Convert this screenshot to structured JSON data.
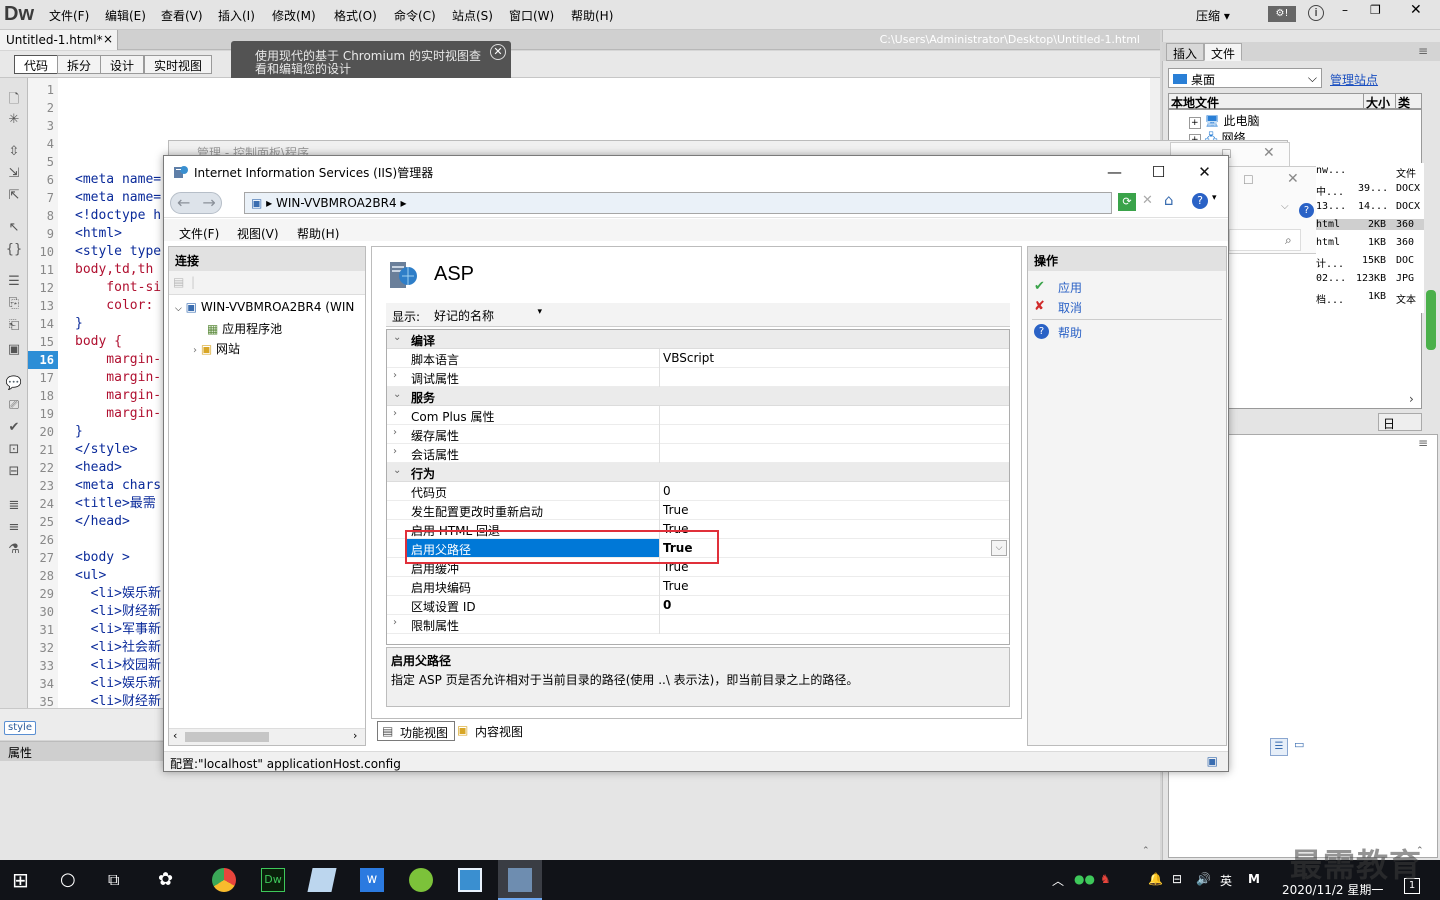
{
  "dw": {
    "logo": "Dw",
    "menus": [
      "文件(F)",
      "编辑(E)",
      "查看(V)",
      "插入(I)",
      "修改(M)",
      "格式(O)",
      "命令(C)",
      "站点(S)",
      "窗口(W)",
      "帮助(H)"
    ],
    "compress": "压缩",
    "doc_tab": "Untitled-1.html*",
    "doc_tab_close": "×",
    "path": "C:\\Users\\Administrator\\Desktop\\Untitled-1.html",
    "view_buttons": [
      "代码",
      "拆分",
      "设计",
      "实时视图"
    ],
    "tip_line1": "使用现代的基于 Chromium 的实时视图查",
    "tip_line2": "看和编辑您的设计",
    "line_numbers": [
      "1",
      "2",
      "3",
      "4",
      "5",
      "6",
      "7",
      "8",
      "9",
      "10",
      "11",
      "12",
      "13",
      "14",
      "15",
      "16",
      "17",
      "18",
      "19",
      "20",
      "21",
      "22",
      "23",
      "24",
      "25",
      "26",
      "27",
      "28",
      "29",
      "30",
      "31",
      "32",
      "33",
      "34",
      "35"
    ],
    "current_line": "16",
    "code_lines": [
      "",
      "",
      "",
      "",
      "",
      "<meta name=",
      "<meta name=",
      "<!doctype h",
      "<html>",
      "<style type",
      "body,td,th",
      "    font-si",
      "    color: ",
      "}",
      "body {",
      "    margin-",
      "    margin-",
      "    margin-",
      "    margin-",
      "}",
      "</style>",
      "<head>",
      "<meta chars",
      "<title>最需",
      "</head>",
      "",
      "<body >",
      "<ul>",
      "  <li>娱乐新",
      "  <li>财经新",
      "  <li>军事新",
      "  <li>社会新",
      "  <li>校园新",
      "  <li>娱乐新",
      "  <li>财经新"
    ],
    "style_tag": "style",
    "props_label": "属性"
  },
  "right_panel": {
    "tabs": [
      "插入",
      "文件"
    ],
    "site": "桌面",
    "manage": "管理站点",
    "col_local": "本地文件",
    "col_size": "大小",
    "col_type": "类型",
    "tree": [
      "此电脑",
      "网络"
    ],
    "files": [
      {
        "name": "nw...",
        "size": "",
        "type": "文件"
      },
      {
        "name": "中...",
        "size": "39...",
        "type": "DOCX"
      },
      {
        "name": "13...",
        "size": "14...",
        "type": "DOCX"
      },
      {
        "name": "html",
        "size": "2KB",
        "type": "360"
      },
      {
        "name": "html",
        "size": "1KB",
        "type": "360"
      },
      {
        "name": "计...",
        "size": "15KB",
        "type": "DOC"
      },
      {
        "name": "02...",
        "size": "123KB",
        "type": "JPG"
      },
      {
        "name": "档...",
        "size": "1KB",
        "type": "文本"
      }
    ],
    "log_button": "日志..."
  },
  "ghost_window": {
    "title": "管理 - 控制面板\\程序"
  },
  "iis": {
    "title": "Internet Information Services (IIS)管理器",
    "address": "WIN-VVBMROA2BR4",
    "menus": [
      "文件(F)",
      "视图(V)",
      "帮助(H)"
    ],
    "connections_header": "连接",
    "tree": {
      "server": "WIN-VVBMROA2BR4 (WIN",
      "app_pools": "应用程序池",
      "sites": "网站"
    },
    "page_title": "ASP",
    "show_label": "显示:",
    "show_value": "好记的名称",
    "rows": [
      {
        "type": "section",
        "key": "编译",
        "expander": "⌄"
      },
      {
        "type": "item",
        "key": "脚本语言",
        "value": "VBScript"
      },
      {
        "type": "group",
        "key": "调试属性",
        "expander": "›"
      },
      {
        "type": "section",
        "key": "服务",
        "expander": "⌄"
      },
      {
        "type": "group",
        "key": "Com Plus 属性",
        "expander": "›"
      },
      {
        "type": "group",
        "key": "缓存属性",
        "expander": "›"
      },
      {
        "type": "group",
        "key": "会话属性",
        "expander": "›"
      },
      {
        "type": "section",
        "key": "行为",
        "expander": "⌄"
      },
      {
        "type": "item",
        "key": "代码页",
        "value": "0"
      },
      {
        "type": "item",
        "key": "发生配置更改时重新启动",
        "value": "True"
      },
      {
        "type": "item",
        "key": "启用 HTML 回退",
        "value": "True"
      },
      {
        "type": "selected",
        "key": "启用父路径",
        "value": "True"
      },
      {
        "type": "item",
        "key": "启用缓冲",
        "value": "True"
      },
      {
        "type": "item",
        "key": "启用块编码",
        "value": "True"
      },
      {
        "type": "itembold",
        "key": "区域设置 ID",
        "value": "0"
      },
      {
        "type": "group",
        "key": "限制属性",
        "expander": "›"
      }
    ],
    "desc_title": "启用父路径",
    "desc_text": "指定 ASP 页是否允许相对于当前目录的路径(使用 ..\\ 表示法)，即当前目录之上的路径。",
    "tab_feature": "功能视图",
    "tab_content": "内容视图",
    "actions_header": "操作",
    "actions": [
      "应用",
      "取消",
      "帮助"
    ],
    "status": "配置:\"localhost\" applicationHost.config"
  },
  "taskbar": {
    "ime": "英",
    "ime2": "M",
    "time": "2020/11/2 星期一",
    "notify": "1"
  },
  "watermark": "最需教育",
  "colors": {
    "accent": "#0078d7",
    "highlight": "#e0303a",
    "dw_current_line": "#2d8ed6"
  }
}
